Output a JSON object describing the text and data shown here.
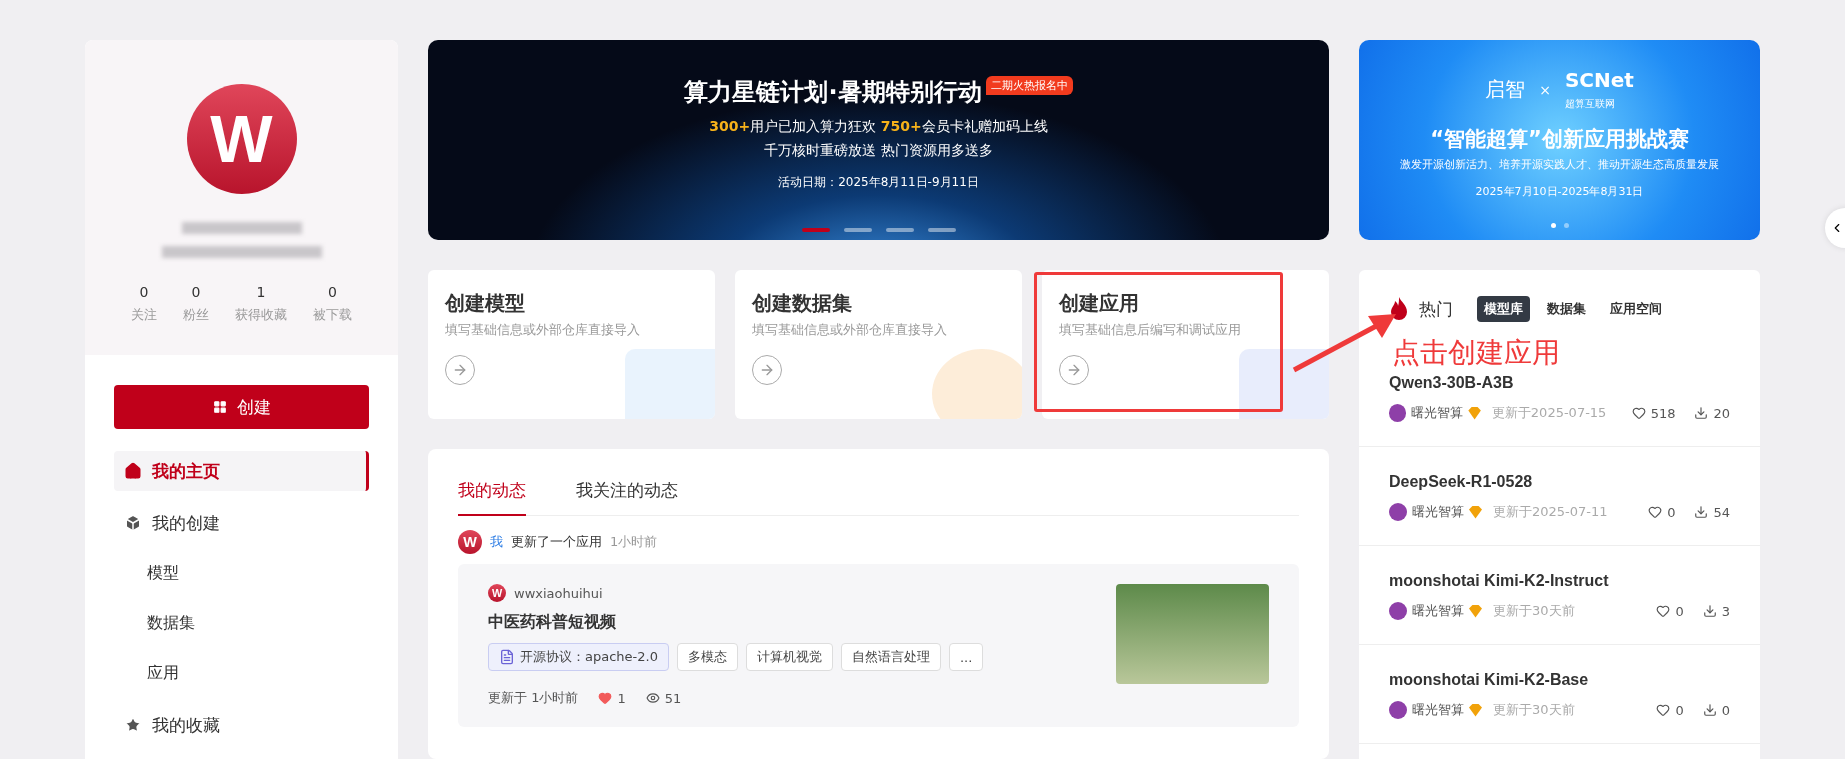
{
  "profile": {
    "avatar_letter": "W",
    "stats": [
      {
        "value": "0",
        "label": "关注"
      },
      {
        "value": "0",
        "label": "粉丝"
      },
      {
        "value": "1",
        "label": "获得收藏"
      },
      {
        "value": "0",
        "label": "被下载"
      }
    ],
    "create_button": "创建",
    "menu": [
      {
        "label": "我的主页",
        "selected": true
      },
      {
        "label": "我的创建",
        "selected": false,
        "children": [
          {
            "label": "模型",
            "selected": false
          },
          {
            "label": "数据集",
            "selected": false
          },
          {
            "label": "应用",
            "selected": false
          }
        ]
      },
      {
        "label": "我的收藏",
        "selected": false
      }
    ]
  },
  "banner": {
    "title": "算力星链计划·暑期特别行动",
    "badge": "二期火热报名中",
    "line1": "**300+**用户已加入算力狂欢 **750+**会员卡礼赠加码上线",
    "line2": "千万核时重磅放送 热门资源用多送多",
    "date": "活动日期：2025年8月11日-9月11日",
    "dots": [
      {
        "selected": true
      },
      {
        "selected": false
      },
      {
        "selected": false
      },
      {
        "selected": false
      }
    ]
  },
  "side_banner": {
    "logo_left": "启智",
    "cross": "×",
    "logo_right": "SCNet",
    "logo_right_sub": "超算互联网",
    "title": "“智能超算”创新应用挑战赛",
    "subtitle": "激发开源创新活力、培养开源实践人才、推动开源生态高质量发展",
    "date": "2025年7月10日-2025年8月31日",
    "dots": [
      {
        "selected": true
      },
      {
        "selected": false
      }
    ]
  },
  "create_cards": [
    {
      "title": "创建模型",
      "desc": "填写基础信息或外部仓库直接导入",
      "kind": "model"
    },
    {
      "title": "创建数据集",
      "desc": "填写基础信息或外部仓库直接导入",
      "kind": "dataset"
    },
    {
      "title": "创建应用",
      "desc": "填写基础信息后编写和调试应用",
      "kind": "app"
    }
  ],
  "annotation": {
    "text": "点击创建应用"
  },
  "feed": {
    "tabs": [
      {
        "label": "我的动态",
        "selected": true
      },
      {
        "label": "我关注的动态",
        "selected": false
      }
    ],
    "activity": {
      "avatar_letter": "W",
      "actor": "我",
      "action": "更新了一个应用",
      "time": "1小时前",
      "card": {
        "avatar_letter": "W",
        "user": "wwxiaohuihui",
        "title": "中医药科普短视频",
        "tags": [
          {
            "label": "开源协议：apache-2.0",
            "kind": "license"
          },
          {
            "label": "多模态",
            "kind": "plain"
          },
          {
            "label": "计算机视觉",
            "kind": "plain"
          },
          {
            "label": "自然语言处理",
            "kind": "plain"
          },
          {
            "label": "...",
            "kind": "plain"
          }
        ],
        "updated": "更新于 1小时前",
        "likes": "1",
        "views": "51"
      }
    }
  },
  "hot": {
    "title": "热门",
    "tabs": [
      {
        "label": "模型库",
        "selected": true
      },
      {
        "label": "数据集",
        "selected": false
      },
      {
        "label": "应用空间",
        "selected": false
      }
    ],
    "items": [
      {
        "name": "Qwen3-30B-A3B",
        "org": "曙光智算",
        "updated": "更新于2025-07-15",
        "likes": "518",
        "downloads": "20"
      },
      {
        "name": "DeepSeek-R1-0528",
        "org": "曙光智算",
        "updated": "更新于2025-07-11",
        "likes": "0",
        "downloads": "54"
      },
      {
        "name": "moonshotai Kimi-K2-Instruct",
        "org": "曙光智算",
        "updated": "更新于30天前",
        "likes": "0",
        "downloads": "3"
      },
      {
        "name": "moonshotai Kimi-K2-Base",
        "org": "曙光智算",
        "updated": "更新于30天前",
        "likes": "0",
        "downloads": "0"
      }
    ]
  }
}
